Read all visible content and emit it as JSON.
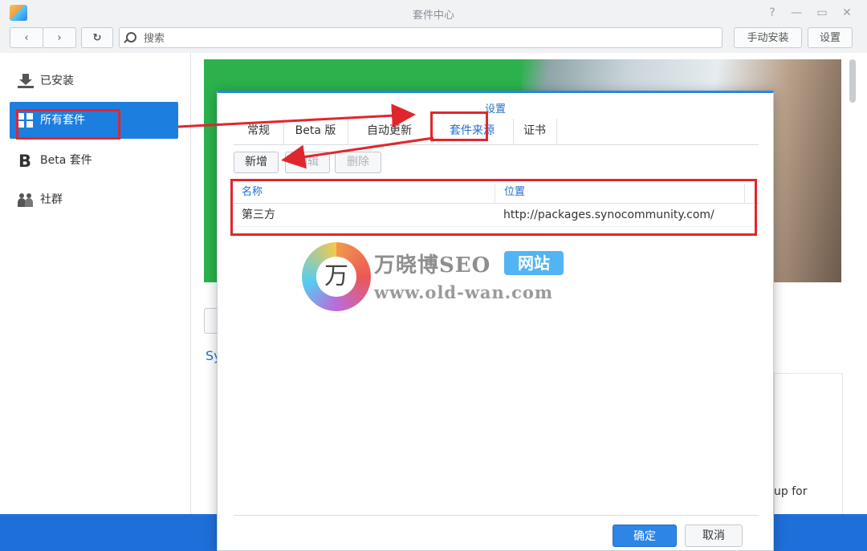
{
  "window": {
    "title": "套件中心",
    "controls": {
      "help": "?",
      "minimize": "—",
      "maximize": "▭",
      "close": "✕"
    }
  },
  "toolbar": {
    "back_icon": "chevron-left-icon",
    "forward_icon": "chevron-right-icon",
    "refresh_icon": "refresh-icon",
    "search_placeholder": "搜索",
    "manual_install_label": "手动安装",
    "settings_label": "设置"
  },
  "sidebar": {
    "items": [
      {
        "label": "已安装",
        "icon": "download-icon"
      },
      {
        "label": "所有套件",
        "icon": "grid-icon",
        "active": true
      },
      {
        "label": "Beta 套件",
        "icon": "beta-icon"
      },
      {
        "label": "社群",
        "icon": "community-icon"
      }
    ]
  },
  "background": {
    "heading_fragment": "Sy",
    "card_text_fragment": "up for"
  },
  "dialog": {
    "title": "设置",
    "tabs": [
      {
        "label": "常规"
      },
      {
        "label": "Beta 版"
      },
      {
        "label": "自动更新"
      },
      {
        "label": "套件来源",
        "active": true
      },
      {
        "label": "证书"
      }
    ],
    "buttons": {
      "add": "新增",
      "edit": "编辑",
      "delete": "删除"
    },
    "table": {
      "columns": [
        "名称",
        "位置"
      ],
      "rows": [
        [
          "第三方",
          "http://packages.synocommunity.com/"
        ]
      ]
    },
    "footer": {
      "ok": "确定",
      "cancel": "取消"
    }
  },
  "watermark": {
    "glyph": "万",
    "name": "万晓博SEO",
    "tag": "网站",
    "url": "www.old-wan.com"
  },
  "colors": {
    "accent": "#1c7fe0",
    "annotation_red": "#e0262d",
    "banner_green": "#2bb24c"
  }
}
